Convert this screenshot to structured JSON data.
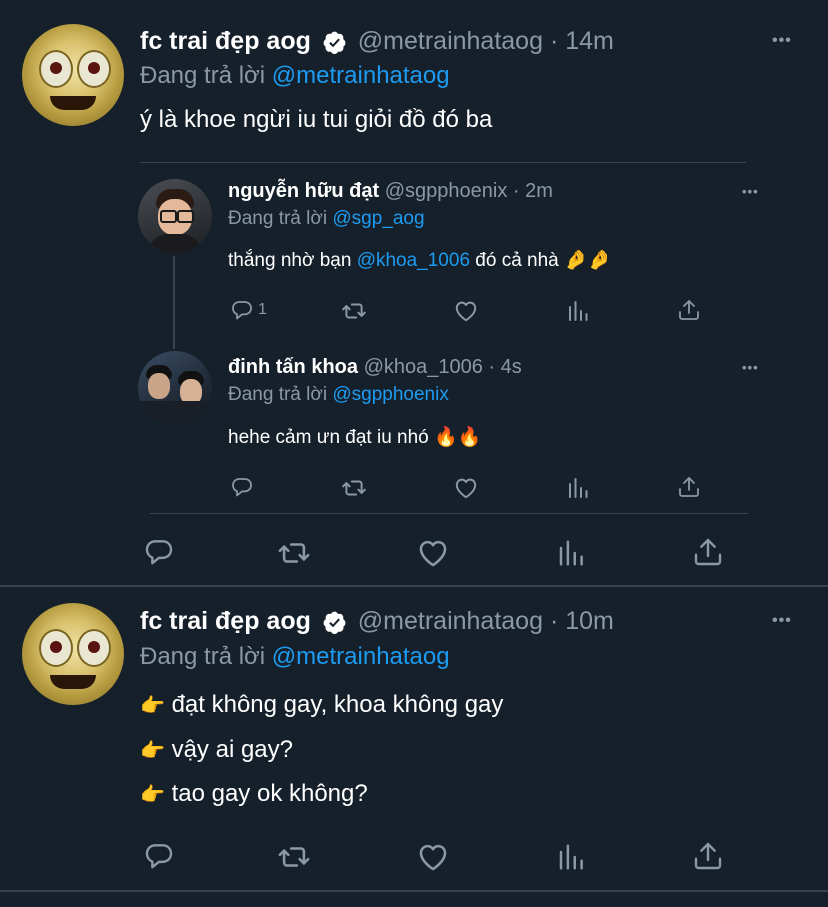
{
  "tweet1": {
    "display_name": "fc trai đẹp aog",
    "handle": "@metrainhataog",
    "dot": "·",
    "time": "14m",
    "replying_prefix": "Đang trả lời",
    "replying_to": "@metrainhataog",
    "text": "ý là khoe ngừi iu tui giỏi đồ đó ba",
    "more": "•••"
  },
  "quote1": {
    "display_name": "nguyễn hữu đạt",
    "handle": "@sgpphoenix",
    "dot": "·",
    "time": "2m",
    "replying_prefix": "Đang trả lời",
    "replying_to": "@sgp_aog",
    "text_before": "thắng nhờ bạn ",
    "mention": "@khoa_1006",
    "text_after": " đó cả nhà ",
    "emoji": "🤌🤌",
    "reply_count": "1",
    "more": "•••"
  },
  "quote2": {
    "display_name": "đinh tấn khoa",
    "handle": "@khoa_1006",
    "dot": "·",
    "time": "4s",
    "replying_prefix": "Đang trả lời",
    "replying_to": "@sgpphoenix",
    "text": "hehe cảm ưn đạt iu nhó ",
    "emoji": "🔥🔥",
    "more": "•••"
  },
  "tweet2": {
    "display_name": "fc trai đẹp aog",
    "handle": "@metrainhataog",
    "dot": "·",
    "time": "10m",
    "replying_prefix": "Đang trả lời",
    "replying_to": "@metrainhataog",
    "bullet": "👉",
    "lines": [
      "đạt không gay, khoa không gay",
      "vậy ai gay?",
      "tao gay ok không?"
    ],
    "more": "•••"
  },
  "icons": {
    "reply": "reply-icon",
    "retweet": "retweet-icon",
    "like": "heart-icon",
    "analytics": "analytics-icon",
    "share": "share-icon",
    "verified": "verified-badge-icon"
  },
  "colors": {
    "background": "#15202b",
    "link": "#1d9bf0",
    "muted": "#8b98a5",
    "divider": "#38444d"
  }
}
